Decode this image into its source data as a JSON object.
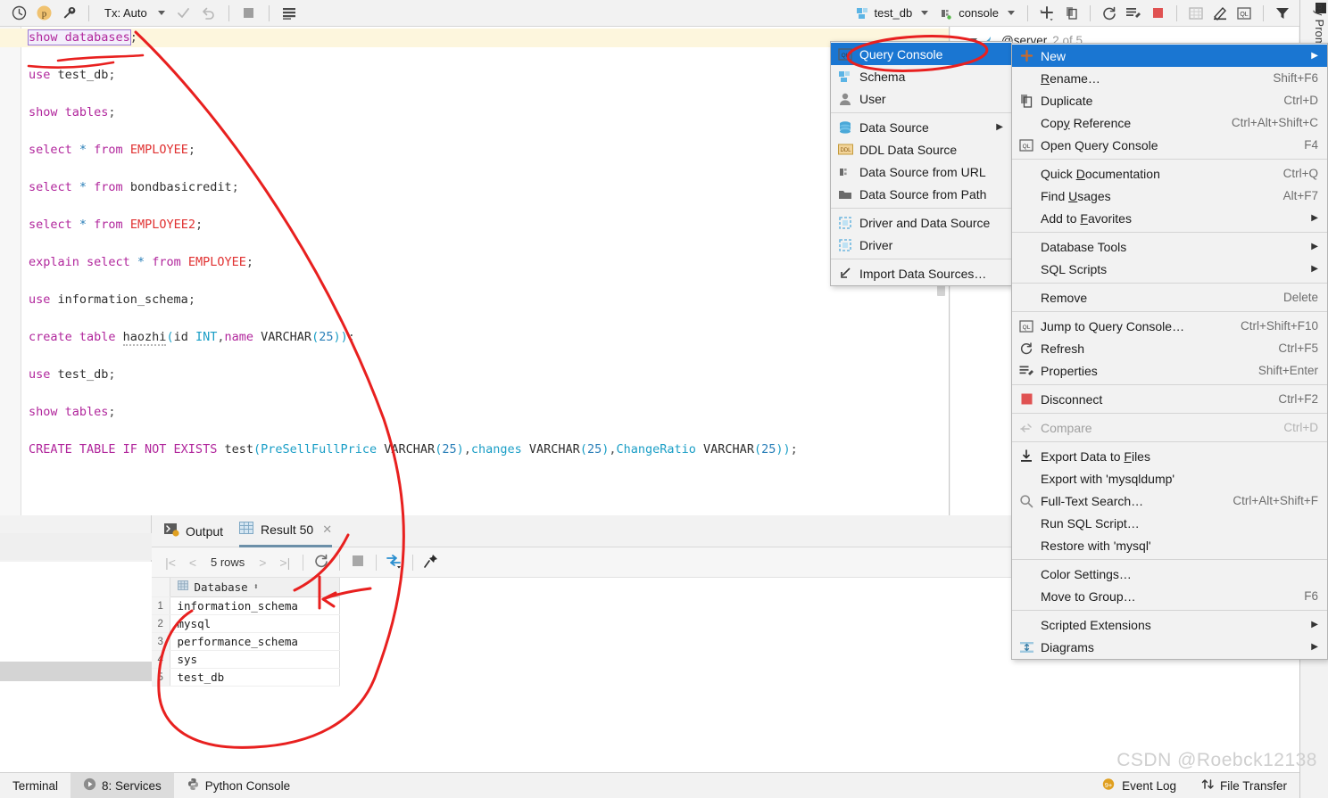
{
  "toolbar": {
    "clock_icon": "history-icon",
    "profile_icon": "profile-avatar-icon",
    "wrench_icon": "wrench-icon",
    "tx_label": "Tx: Auto",
    "commit_icon": "check-icon",
    "rollback_icon": "rollback-icon",
    "stop_icon": "stop-icon",
    "grid_icon": "data-grid-icon",
    "datasource_label": "test_db",
    "console_label": "console",
    "add_icon": "plus-icon",
    "copy_icon": "duplicate-icon",
    "refresh_icon": "refresh-icon",
    "properties_icon": "properties-icon",
    "disconnect_icon": "disconnect-icon",
    "table_icon": "table-icon",
    "edit_icon": "edit-icon",
    "ql_icon": "query-console-icon",
    "filter_icon": "filter-icon"
  },
  "editor": {
    "selected_text": "show databases",
    "lines": [
      {
        "id": "l1",
        "highlight": true,
        "tokens": [
          {
            "t": "show databases",
            "c": "kw sel-box"
          },
          {
            "t": ";",
            "c": "pun"
          }
        ]
      },
      {
        "id": "l2",
        "tokens": []
      },
      {
        "id": "l3",
        "tokens": [
          {
            "t": "use ",
            "c": "kw"
          },
          {
            "t": "test_db",
            "c": "id"
          },
          {
            "t": ";",
            "c": "pun"
          }
        ]
      },
      {
        "id": "l4",
        "tokens": []
      },
      {
        "id": "l5",
        "tokens": [
          {
            "t": "show tables",
            "c": "kw"
          },
          {
            "t": ";",
            "c": "pun"
          }
        ]
      },
      {
        "id": "l6",
        "tokens": []
      },
      {
        "id": "l7",
        "tokens": [
          {
            "t": "select ",
            "c": "kw"
          },
          {
            "t": "*",
            "c": "op"
          },
          {
            "t": " from ",
            "c": "kw"
          },
          {
            "t": "EMPLOYEE",
            "c": "tbl"
          },
          {
            "t": ";",
            "c": "pun"
          }
        ]
      },
      {
        "id": "l8",
        "tokens": []
      },
      {
        "id": "l9",
        "tokens": [
          {
            "t": "select ",
            "c": "kw"
          },
          {
            "t": "*",
            "c": "op"
          },
          {
            "t": " from ",
            "c": "kw"
          },
          {
            "t": "bondbasicredit",
            "c": "id"
          },
          {
            "t": ";",
            "c": "pun"
          }
        ]
      },
      {
        "id": "l10",
        "tokens": []
      },
      {
        "id": "l11",
        "tokens": [
          {
            "t": "select ",
            "c": "kw"
          },
          {
            "t": "*",
            "c": "op"
          },
          {
            "t": " from ",
            "c": "kw"
          },
          {
            "t": "EMPLOYEE2",
            "c": "tbl"
          },
          {
            "t": ";",
            "c": "pun"
          }
        ]
      },
      {
        "id": "l12",
        "tokens": []
      },
      {
        "id": "l13",
        "tokens": [
          {
            "t": "explain select ",
            "c": "kw"
          },
          {
            "t": "*",
            "c": "op"
          },
          {
            "t": " from ",
            "c": "kw"
          },
          {
            "t": "EMPLOYEE",
            "c": "tbl"
          },
          {
            "t": ";",
            "c": "pun"
          }
        ]
      },
      {
        "id": "l14",
        "tokens": []
      },
      {
        "id": "l15",
        "tokens": [
          {
            "t": "use ",
            "c": "kw"
          },
          {
            "t": "information_schema",
            "c": "id"
          },
          {
            "t": ";",
            "c": "pun"
          }
        ]
      },
      {
        "id": "l16",
        "tokens": []
      },
      {
        "id": "l17",
        "tokens": [
          {
            "t": "create table ",
            "c": "kw"
          },
          {
            "t": "haozhi",
            "c": "id squiggle"
          },
          {
            "t": "(",
            "c": "col"
          },
          {
            "t": "id ",
            "c": "id"
          },
          {
            "t": "INT",
            "c": "col"
          },
          {
            "t": ",",
            "c": "pun"
          },
          {
            "t": "name ",
            "c": "kw"
          },
          {
            "t": "VARCHAR",
            "c": "id"
          },
          {
            "t": "(",
            "c": "col"
          },
          {
            "t": "25",
            "c": "num"
          },
          {
            "t": "))",
            "c": "col"
          },
          {
            "t": ";",
            "c": "pun"
          }
        ]
      },
      {
        "id": "l18",
        "tokens": []
      },
      {
        "id": "l19",
        "tokens": [
          {
            "t": "use ",
            "c": "kw"
          },
          {
            "t": "test_db",
            "c": "id"
          },
          {
            "t": ";",
            "c": "pun"
          }
        ]
      },
      {
        "id": "l20",
        "tokens": []
      },
      {
        "id": "l21",
        "tokens": [
          {
            "t": "show tables",
            "c": "kw"
          },
          {
            "t": ";",
            "c": "pun"
          }
        ]
      },
      {
        "id": "l22",
        "tokens": []
      },
      {
        "id": "l23",
        "tokens": [
          {
            "t": "CREATE TABLE IF NOT EXISTS ",
            "c": "kw"
          },
          {
            "t": "test",
            "c": "id"
          },
          {
            "t": "(",
            "c": "col"
          },
          {
            "t": "PreSellFullPrice ",
            "c": "col"
          },
          {
            "t": "VARCHAR",
            "c": "id"
          },
          {
            "t": "(",
            "c": "col"
          },
          {
            "t": "25",
            "c": "num"
          },
          {
            "t": ")",
            "c": "col"
          },
          {
            "t": ",",
            "c": "pun"
          },
          {
            "t": "changes ",
            "c": "col"
          },
          {
            "t": "VARCHAR",
            "c": "id"
          },
          {
            "t": "(",
            "c": "col"
          },
          {
            "t": "25",
            "c": "num"
          },
          {
            "t": ")",
            "c": "col"
          },
          {
            "t": ",",
            "c": "pun"
          },
          {
            "t": "ChangeRatio ",
            "c": "col"
          },
          {
            "t": "VARCHAR",
            "c": "id"
          },
          {
            "t": "(",
            "c": "col"
          },
          {
            "t": "25",
            "c": "num"
          },
          {
            "t": "))",
            "c": "col"
          },
          {
            "t": ";",
            "c": "pun"
          }
        ]
      }
    ]
  },
  "tree": {
    "server_label": "@server",
    "server_count": "2 of 5"
  },
  "menu_new": {
    "items": [
      {
        "label": "Query Console",
        "icon": "query-console-icon",
        "highlight": true
      },
      {
        "label": "Schema",
        "icon": "schema-icon"
      },
      {
        "label": "User",
        "icon": "user-icon"
      },
      {
        "sep": true
      },
      {
        "label": "Data Source",
        "icon": "data-source-icon",
        "arrow": true
      },
      {
        "label": "DDL Data Source",
        "icon": "ddl-icon"
      },
      {
        "label": "Data Source from URL",
        "icon": "plug-icon"
      },
      {
        "label": "Data Source from Path",
        "icon": "folder-icon"
      },
      {
        "sep": true
      },
      {
        "label": "Driver and Data Source",
        "icon": "driver-icon"
      },
      {
        "label": "Driver",
        "icon": "driver-icon"
      },
      {
        "sep": true
      },
      {
        "label": "Import Data Sources…",
        "icon": "import-icon"
      }
    ]
  },
  "menu_main": {
    "items": [
      {
        "label": "New",
        "icon": "plus-icon",
        "arrow": true,
        "highlight": true
      },
      {
        "label": "Rename…",
        "shortcut": "Shift+F6",
        "mnemonic": "R"
      },
      {
        "label": "Duplicate",
        "shortcut": "Ctrl+D",
        "icon": "duplicate-icon"
      },
      {
        "label": "Copy Reference",
        "shortcut": "Ctrl+Alt+Shift+C",
        "mnemonic": "y"
      },
      {
        "label": "Open Query Console",
        "shortcut": "F4",
        "icon": "query-console-icon"
      },
      {
        "sep": true
      },
      {
        "label": "Quick Documentation",
        "shortcut": "Ctrl+Q",
        "mnemonic": "D"
      },
      {
        "label": "Find Usages",
        "shortcut": "Alt+F7",
        "mnemonic": "U"
      },
      {
        "label": "Add to Favorites",
        "arrow": true,
        "mnemonic": "F"
      },
      {
        "sep": true
      },
      {
        "label": "Database Tools",
        "arrow": true
      },
      {
        "label": "SQL Scripts",
        "arrow": true
      },
      {
        "sep": true
      },
      {
        "label": "Remove",
        "shortcut": "Delete"
      },
      {
        "sep": true
      },
      {
        "label": "Jump to Query Console…",
        "shortcut": "Ctrl+Shift+F10",
        "icon": "query-console-icon"
      },
      {
        "label": "Refresh",
        "shortcut": "Ctrl+F5",
        "icon": "refresh-icon"
      },
      {
        "label": "Properties",
        "shortcut": "Shift+Enter",
        "icon": "properties-icon"
      },
      {
        "sep": true
      },
      {
        "label": "Disconnect",
        "shortcut": "Ctrl+F2",
        "icon": "disconnect-icon"
      },
      {
        "sep": true
      },
      {
        "label": "Compare",
        "shortcut": "Ctrl+D",
        "icon": "compare-icon",
        "disabled": true
      },
      {
        "sep": true
      },
      {
        "label": "Export Data to Files",
        "icon": "export-icon",
        "mnemonic": "F"
      },
      {
        "label": "Export with 'mysqldump'"
      },
      {
        "label": "Full-Text Search…",
        "shortcut": "Ctrl+Alt+Shift+F",
        "icon": "search-icon"
      },
      {
        "label": "Run SQL Script…"
      },
      {
        "label": "Restore with 'mysql'"
      },
      {
        "sep": true
      },
      {
        "label": "Color Settings…"
      },
      {
        "label": "Move to Group…",
        "shortcut": "F6"
      },
      {
        "sep": true
      },
      {
        "label": "Scripted Extensions",
        "arrow": true
      },
      {
        "label": "Diagrams",
        "arrow": true,
        "icon": "diagram-icon"
      }
    ]
  },
  "results": {
    "tabs": [
      {
        "label": "Output",
        "icon": "output-icon",
        "active": false
      },
      {
        "label": "Result 50",
        "icon": "result-grid-icon",
        "active": true,
        "closable": true
      }
    ],
    "toolbar": {
      "first_icon": "first-page-icon",
      "prev_icon": "prev-page-icon",
      "rows_label": "5 rows",
      "next_icon": "next-page-icon",
      "last_icon": "last-page-icon",
      "reload_icon": "reload-icon",
      "stop_icon": "stop-icon",
      "transpose_icon": "transpose-icon",
      "pin_icon": "pin-icon"
    },
    "grid": {
      "columns": [
        "Database"
      ],
      "rows": [
        {
          "n": "1",
          "values": [
            "information_schema"
          ]
        },
        {
          "n": "2",
          "values": [
            "mysql"
          ]
        },
        {
          "n": "3",
          "values": [
            "performance_schema"
          ]
        },
        {
          "n": "4",
          "values": [
            "sys"
          ]
        },
        {
          "n": "5",
          "values": [
            "test_db"
          ]
        }
      ]
    }
  },
  "statusbar": {
    "left": [
      {
        "label": "Terminal",
        "icon": "terminal-icon",
        "selected": false
      },
      {
        "label": "8: Services",
        "icon": "services-run-icon",
        "selected": true
      },
      {
        "label": "Python Console",
        "icon": "python-icon",
        "selected": false
      }
    ],
    "right": [
      {
        "label": "Event Log",
        "icon": "event-log-icon",
        "badge": "9+"
      },
      {
        "label": "File Transfer",
        "icon": "file-transfer-icon"
      }
    ]
  },
  "rail": {
    "vertical_label": "ey Prom"
  },
  "watermark": "CSDN @Roebck12138",
  "colors": {
    "accent": "#1a76d2",
    "keyword": "#b1269c",
    "table": "#e03131",
    "column": "#1a9ec6",
    "highlight_line": "#fdf6dd",
    "ink": "#e8201f"
  }
}
